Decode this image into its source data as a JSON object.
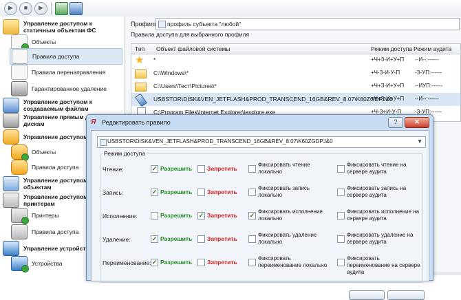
{
  "toolbar": {
    "buttons": [
      "play-icon",
      "stop-icon",
      "forward-icon",
      "apply-icon",
      "save-icon"
    ]
  },
  "tree": [
    {
      "label": "Управление доступом к статичным объектам ФС",
      "bold": true,
      "icon": "folder-icon"
    },
    {
      "label": "Объекты",
      "bold": false,
      "icon": "document-icon"
    },
    {
      "label": "Правила доступа",
      "bold": false,
      "icon": "document-edit-icon",
      "selected": true
    },
    {
      "label": "Правила перенаправления",
      "bold": false,
      "icon": "redirect-icon"
    },
    {
      "label": "Гарантированное удаление",
      "bold": false,
      "icon": "trash-icon"
    },
    {
      "label": "Управление доступом к создаваемым файлам",
      "bold": true,
      "icon": "files-icon"
    },
    {
      "label": "Управление прямым доступом к дискам",
      "bold": true,
      "icon": "disk-icon"
    },
    {
      "label": "Управление доступом к реестру",
      "bold": true,
      "icon": "registry-icon"
    },
    {
      "label": "Объекты",
      "bold": false,
      "icon": "puzzle-icon"
    },
    {
      "label": "Правила доступа",
      "bold": false,
      "icon": "puzzle-edit-icon"
    },
    {
      "label": "Управление доступом к сетевым объектам",
      "bold": true,
      "icon": "network-icon"
    },
    {
      "label": "Управление доступом к принтерам",
      "bold": true,
      "icon": "printer-group-icon"
    },
    {
      "label": "Принтеры",
      "bold": false,
      "icon": "printer-icon"
    },
    {
      "label": "Правила доступа",
      "bold": false,
      "icon": "printer-edit-icon"
    },
    {
      "label": "Управление устройства",
      "bold": true,
      "icon": "devices-icon"
    },
    {
      "label": "Устройства",
      "bold": false,
      "icon": "device-icon"
    }
  ],
  "profile": {
    "label": "Профиль:",
    "value": "профиль субъекта \"любой\""
  },
  "rules_header": "Правила доступа для выбранного профиля",
  "grid": {
    "columns": [
      "Тип",
      "Объект файловой системы",
      "Режим доступа",
      "Режим аудита"
    ],
    "rows": [
      {
        "icon": "star-icon",
        "object": "*",
        "access": "+Ч+З-И+У+П",
        "audit": "--И--:------"
      },
      {
        "icon": "folder-icon",
        "object": "C:\\Windows\\*",
        "access": "+Ч-З-И-У-П",
        "audit": "-З-УП:------"
      },
      {
        "icon": "folder-icon",
        "object": "C:\\Users\\Тест\\Pictures\\*",
        "access": "+Ч+З-И+У+П",
        "audit": "--ИУП:------"
      },
      {
        "icon": "usb-icon",
        "object": "USBSTOR\\DISK&VEN_JETFLASH&PROD_TRANSCEND_16GB&REV_8.07\\K60ZGDPJ&0",
        "access": "+Ч+З-И+У+П",
        "audit": "--И--:------",
        "selected": true
      },
      {
        "icon": "file-icon",
        "object": "C:\\Program Files\\Internet Explorer\\iexplore.exe",
        "access": "+Ч-З+И-У-П",
        "audit": "-З-УП:------"
      }
    ]
  },
  "dialog": {
    "title": "Редактировать правило",
    "logo": "Я",
    "object": "USBSTOR\\DISK&VEN_JETFLASH&PROD_TRANSCEND_16GB&REV_8.07\\K60ZGDPJ&0",
    "group_label": "Режим доступа",
    "allow_label": "Разрешить",
    "deny_label": "Запретить",
    "rows": [
      {
        "op": "Чтение:",
        "allow": true,
        "deny": false,
        "log_local": "Фиксировать чтение локально",
        "log_local_checked": false,
        "log_server": "Фиксировать чтение на сервере аудита",
        "log_server_checked": false
      },
      {
        "op": "Запись:",
        "allow": true,
        "deny": false,
        "log_local": "Фиксировать запись локально",
        "log_local_checked": false,
        "log_server": "Фиксировать запись на сервере аудита",
        "log_server_checked": false
      },
      {
        "op": "Исполнение:",
        "allow": false,
        "deny": true,
        "log_local": "Фиксировать исполнение локально",
        "log_local_checked": true,
        "log_server": "Фиксировать исполнение на сервере аудита",
        "log_server_checked": false
      },
      {
        "op": "Удаление:",
        "allow": true,
        "deny": false,
        "log_local": "Фиксировать удаление локально",
        "log_local_checked": false,
        "log_server": "Фиксировать удаление на сервере аудита",
        "log_server_checked": false
      },
      {
        "op": "Переименование:",
        "allow": true,
        "deny": false,
        "log_local": "Фиксировать переименование локально",
        "log_local_checked": false,
        "log_server": "Фиксировать переименование на сервере аудита",
        "log_server_checked": false
      }
    ]
  },
  "colors": {
    "allow": "#1e8a1e",
    "deny": "#cc2020",
    "selection": "#d8e5f5"
  }
}
